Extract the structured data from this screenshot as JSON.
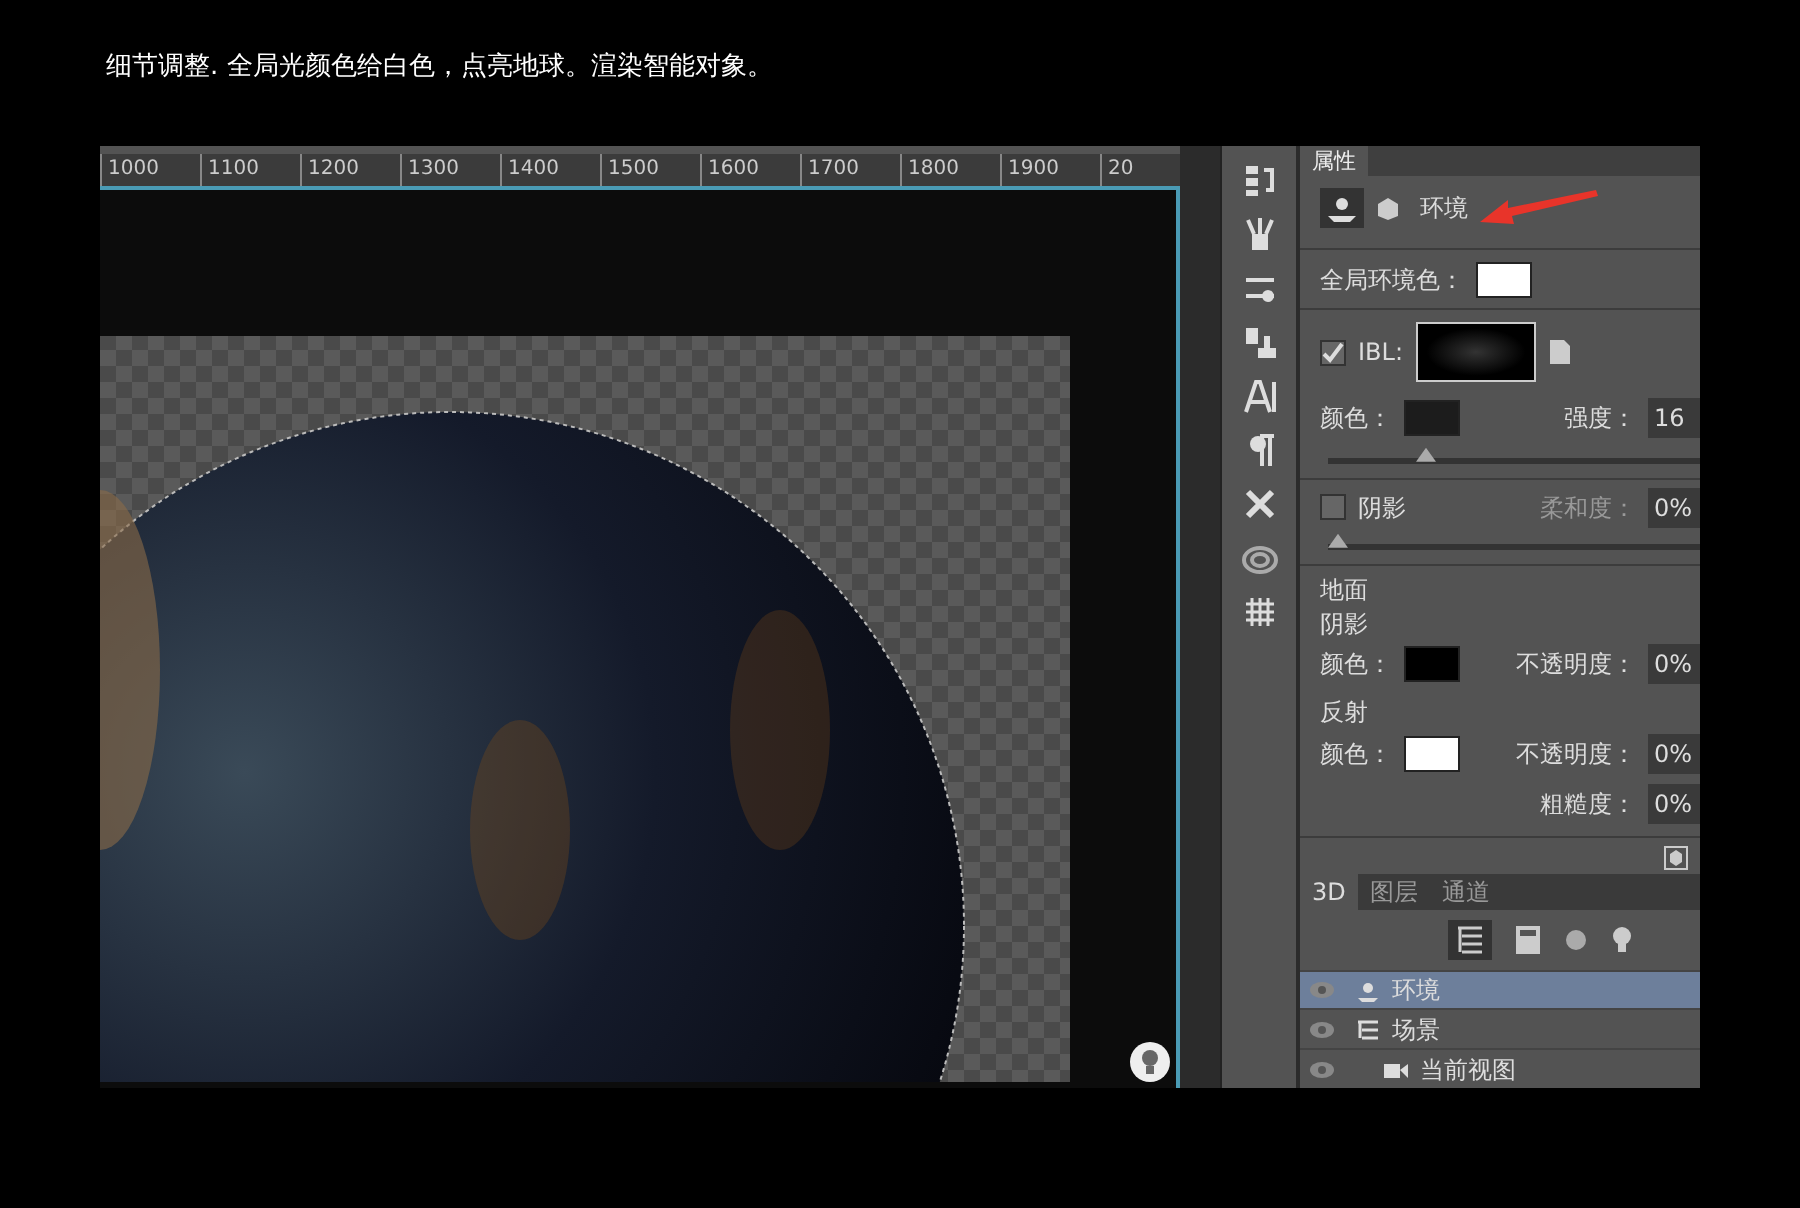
{
  "caption": "细节调整. 全局光颜色给白色，点亮地球。渲染智能对象。",
  "ruler": {
    "labels": [
      "1000",
      "1100",
      "1200",
      "1300",
      "1400",
      "1500",
      "1600",
      "1700",
      "1800",
      "1900",
      "20"
    ]
  },
  "properties_panel": {
    "tab": "属性",
    "header": {
      "title": "环境"
    },
    "global_ambient": {
      "label": "全局环境色：",
      "color": "#ffffff"
    },
    "ibl": {
      "label": "IBL:",
      "checked": true
    },
    "light_color": {
      "label": "颜色：",
      "color": "#1c1c1c",
      "intensity_label": "强度：",
      "intensity_value": "16",
      "level": 0.25
    },
    "shadow": {
      "label": "阴影",
      "checked": false,
      "softness_label": "柔和度：",
      "softness_value": "0%",
      "level": 0
    },
    "ground": {
      "title": "地面",
      "shadow": {
        "title": "阴影",
        "color_label": "颜色：",
        "color": "#000000",
        "opacity_label": "不透明度：",
        "opacity_value": "0%"
      },
      "reflection": {
        "title": "反射",
        "color_label": "颜色：",
        "color": "#ffffff",
        "opacity_label": "不透明度：",
        "opacity_value": "0%",
        "roughness_label": "粗糙度：",
        "roughness_value": "0%"
      }
    }
  },
  "layers_panel": {
    "tabs": [
      {
        "label": "3D",
        "selected": true
      },
      {
        "label": "图层",
        "selected": false
      },
      {
        "label": "通道",
        "selected": false
      }
    ],
    "items": [
      {
        "label": "环境",
        "kind": "environment",
        "selected": true
      },
      {
        "label": "场景",
        "kind": "scene",
        "selected": false,
        "children": [
          {
            "label": "当前视图",
            "kind": "camera",
            "selected": false
          }
        ]
      }
    ]
  }
}
